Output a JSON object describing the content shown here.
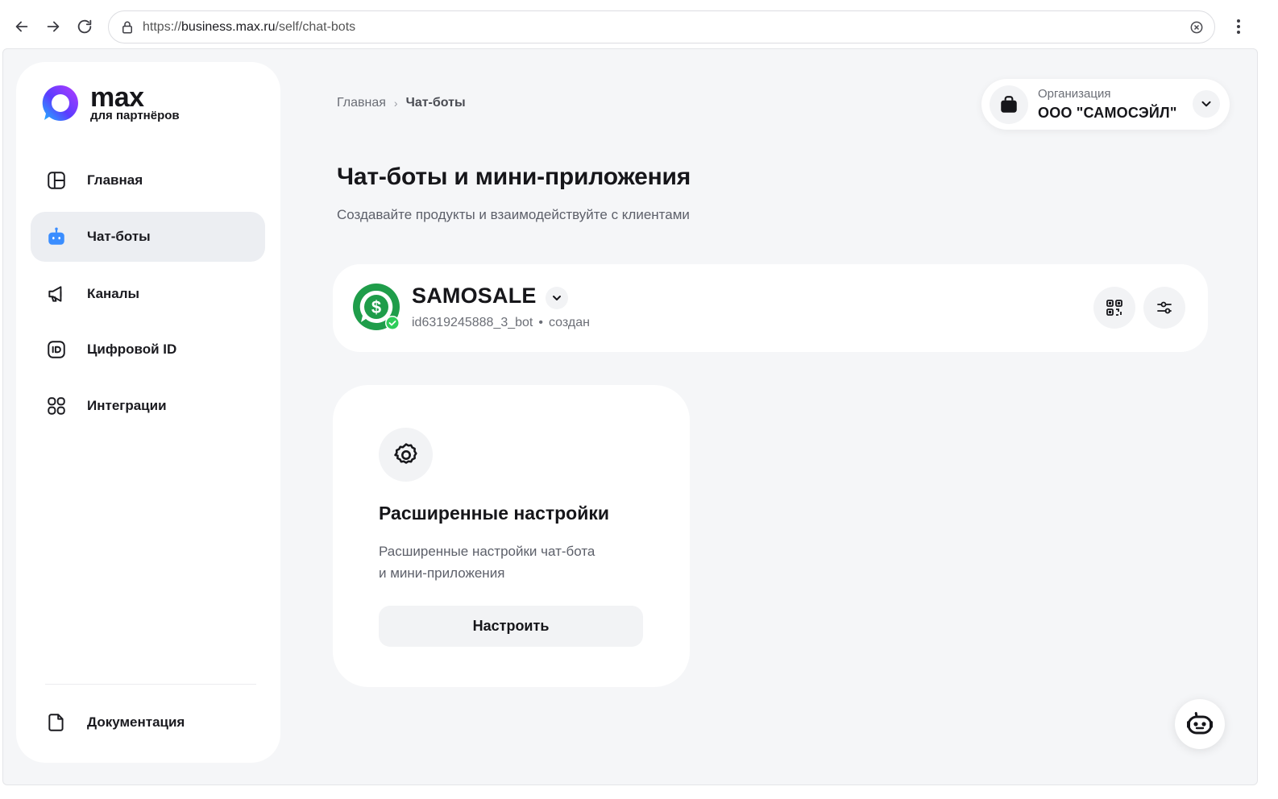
{
  "browser": {
    "url_prefix": "https://",
    "url_host": "business.max.ru",
    "url_path": "/self/chat-bots",
    "icons": [
      "back-arrow-icon",
      "forward-arrow-icon",
      "reload-icon",
      "lock-icon",
      "extension-icon",
      "kebab-menu-icon"
    ]
  },
  "sidebar": {
    "logo": {
      "word": "max",
      "sub": "для партнёров"
    },
    "items": [
      {
        "label": "Главная",
        "icon": "dashboard-icon",
        "active": false
      },
      {
        "label": "Чат-боты",
        "icon": "robot-icon",
        "active": true
      },
      {
        "label": "Каналы",
        "icon": "megaphone-icon",
        "active": false
      },
      {
        "label": "Цифровой ID",
        "icon": "id-card-icon",
        "active": false
      },
      {
        "label": "Интеграции",
        "icon": "grid-icon",
        "active": false
      }
    ],
    "footer_item": {
      "label": "Документация",
      "icon": "document-icon"
    }
  },
  "breadcrumb": {
    "home": "Главная",
    "separator": "›",
    "current": "Чат-боты"
  },
  "organization": {
    "caption": "Организация",
    "name": "ООО \"САМОСЭЙЛ\""
  },
  "header": {
    "title": "Чат-боты и мини-приложения",
    "subtitle": "Создавайте продукты и взаимодействуйте с клиентами"
  },
  "bot": {
    "name": "SAMOSALE",
    "id": "id6319245888_3_bot",
    "dot": "•",
    "status": "создан",
    "avatar_color": "#1f9d4a",
    "verified_color": "#2ecc59"
  },
  "settings_card": {
    "title": "Расширенные настройки",
    "desc_line1": "Расширенные настройки чат-бота",
    "desc_line2": "и мини-приложения",
    "button": "Настроить"
  },
  "colors": {
    "page_bg": "#f5f6f8",
    "active_item_bg": "#eceef2",
    "accent_blue": "#3a8dff"
  }
}
